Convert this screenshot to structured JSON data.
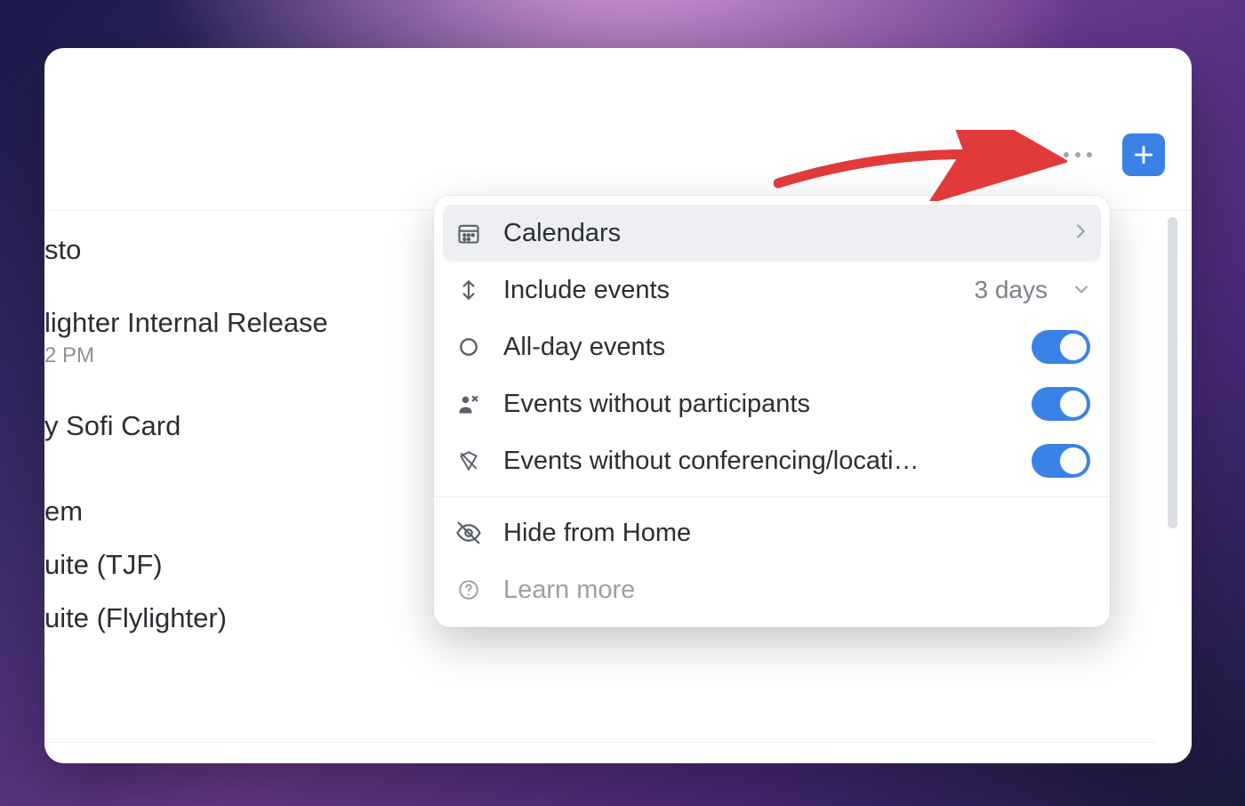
{
  "header": {},
  "events": {
    "item0": "sto",
    "item1": "lighter Internal Release",
    "item1_sub": "2 PM",
    "item2": "y Sofi Card",
    "item3": "em",
    "item4": "uite (TJF)",
    "item5": "uite (Flylighter)"
  },
  "menu": {
    "calendars": "Calendars",
    "include": "Include events",
    "include_val": "3 days",
    "allday": "All-day events",
    "noparticipants": "Events without participants",
    "noconf": "Events without conferencing/locati…",
    "hide": "Hide from Home",
    "learn": "Learn more"
  }
}
